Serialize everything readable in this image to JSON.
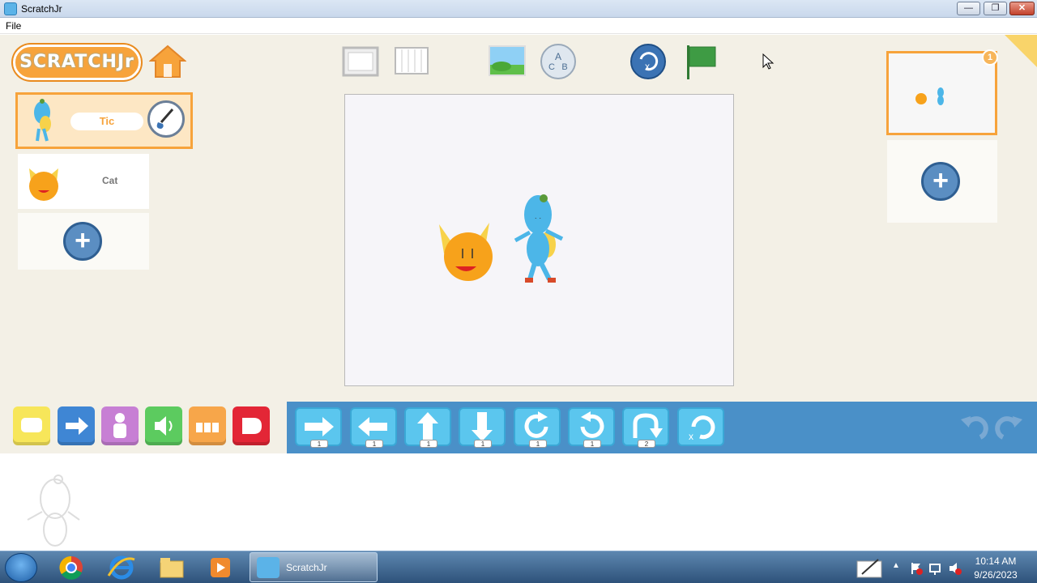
{
  "window": {
    "title": "ScratchJr",
    "controls": {
      "minimize": "—",
      "maximize": "❐",
      "close": "✕"
    }
  },
  "menu": {
    "file": "File"
  },
  "header": {
    "logo_text": "SCRATCHJr"
  },
  "sprites": [
    {
      "name": "Tic",
      "selected": true
    },
    {
      "name": "Cat",
      "selected": false
    }
  ],
  "add_sprite_label": "+",
  "pages": {
    "badge": "1",
    "add_label": "+"
  },
  "category_colors": {
    "triggering": "#f7e65a",
    "motion": "#3f86d4",
    "looks": "#c77fd4",
    "sound": "#5ccb5f",
    "control": "#f7a64a",
    "end": "#e32636"
  },
  "motion_blocks": [
    {
      "name": "move-right",
      "value": "1"
    },
    {
      "name": "move-left",
      "value": "1"
    },
    {
      "name": "move-up",
      "value": "1"
    },
    {
      "name": "move-down",
      "value": "1"
    },
    {
      "name": "turn-right",
      "value": "1"
    },
    {
      "name": "turn-left",
      "value": "1"
    },
    {
      "name": "hop",
      "value": "2"
    },
    {
      "name": "go-home",
      "value": ""
    }
  ],
  "taskbar": {
    "active_task": "ScratchJr",
    "time": "10:14 AM",
    "date": "9/26/2023"
  }
}
